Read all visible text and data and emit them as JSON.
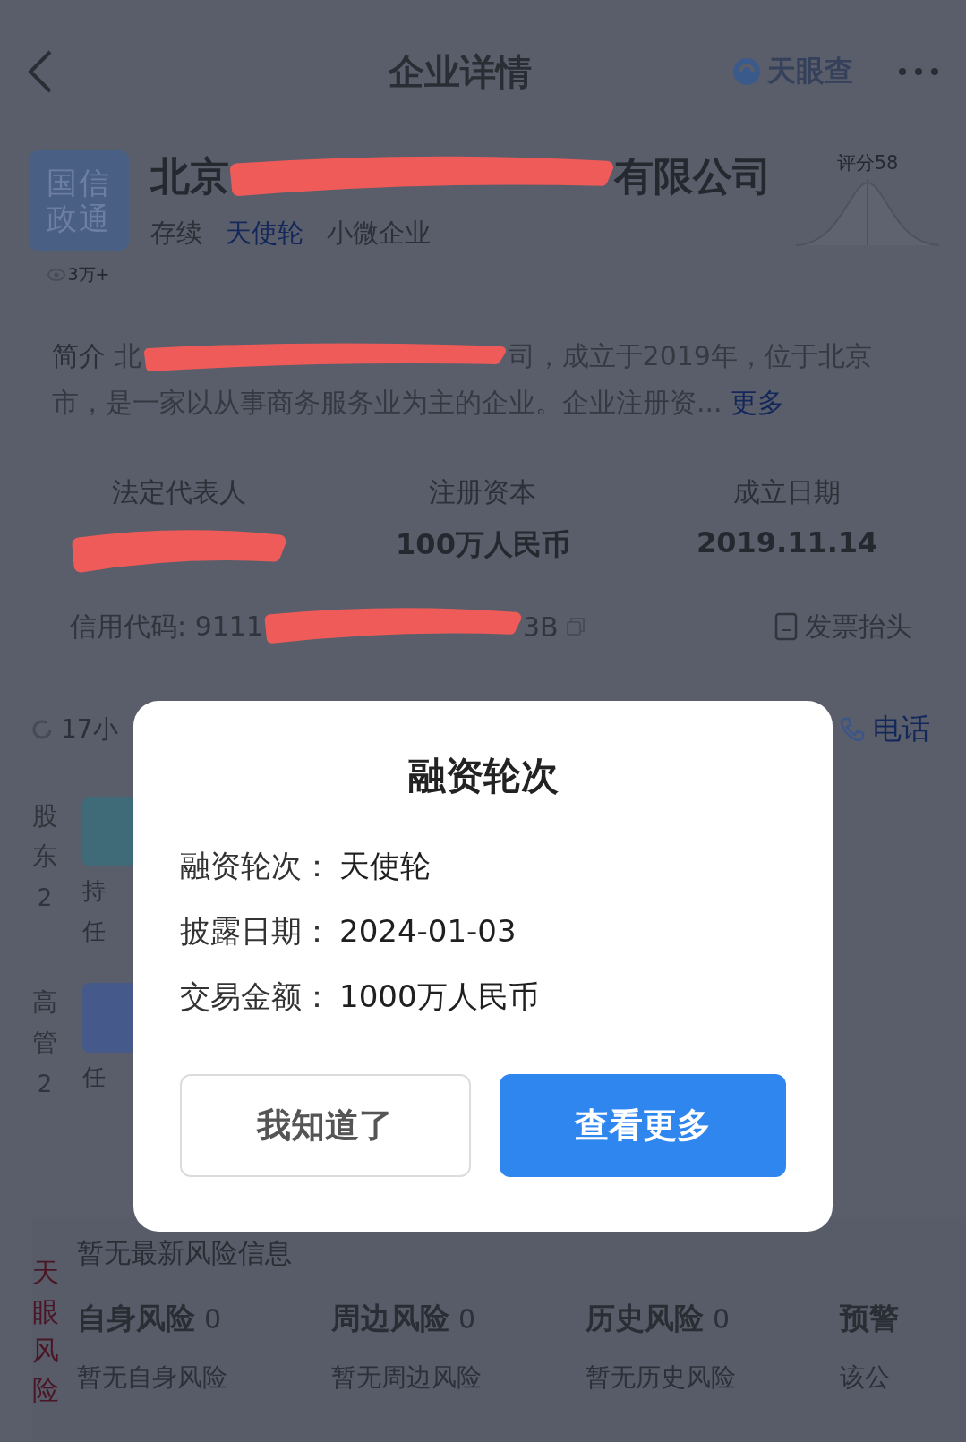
{
  "header": {
    "title": "企业详情",
    "brand": "天眼查"
  },
  "company": {
    "logo_lines": [
      "国信",
      "政通"
    ],
    "name_start": "北京",
    "name_end": "有限公司",
    "views": "3万+",
    "score": "评分58",
    "tags": [
      {
        "label": "存续",
        "highlighted": false
      },
      {
        "label": "天使轮",
        "highlighted": true
      },
      {
        "label": "小微企业",
        "highlighted": false
      }
    ]
  },
  "intro": {
    "label": "简介",
    "text_start": "北",
    "text_end": "司，成立于2019年，位于北京市，是一家以从事商务服务业为主的企业。企业注册资...",
    "more": "更多"
  },
  "facts": [
    {
      "label": "法定代表人"
    },
    {
      "label": "注册资本",
      "value": "100万人民币"
    },
    {
      "label": "成立日期",
      "value": "2019.11.14"
    }
  ],
  "credit": {
    "label": "信用代码: 9111",
    "tail": "3B",
    "invoice": "发票抬头"
  },
  "update": {
    "time": "17小",
    "phone": "电话"
  },
  "people": [
    {
      "label": "股东",
      "count": "2",
      "lines": [
        "持",
        "任"
      ]
    },
    {
      "label": "高管",
      "count": "2",
      "lines": [
        "任"
      ]
    }
  ],
  "risk": {
    "label": "天眼风险",
    "headline": "暂无最新风险信息",
    "columns": [
      {
        "title": "自身风险",
        "count": "0",
        "note": "暂无自身风险"
      },
      {
        "title": "周边风险",
        "count": "0",
        "note": "暂无周边风险"
      },
      {
        "title": "历史风险",
        "count": "0",
        "note": "暂无历史风险"
      },
      {
        "title": "预警",
        "note": "该公"
      }
    ]
  },
  "dialog": {
    "title": "融资轮次",
    "rows": [
      {
        "label": "融资轮次：",
        "value": "天使轮"
      },
      {
        "label": "披露日期：",
        "value": "2024-01-03"
      },
      {
        "label": "交易金额：",
        "value": "1000万人民币"
      }
    ],
    "buttons": [
      {
        "label": "我知道了",
        "kind": "secondary"
      },
      {
        "label": "查看更多",
        "kind": "primary"
      }
    ]
  }
}
